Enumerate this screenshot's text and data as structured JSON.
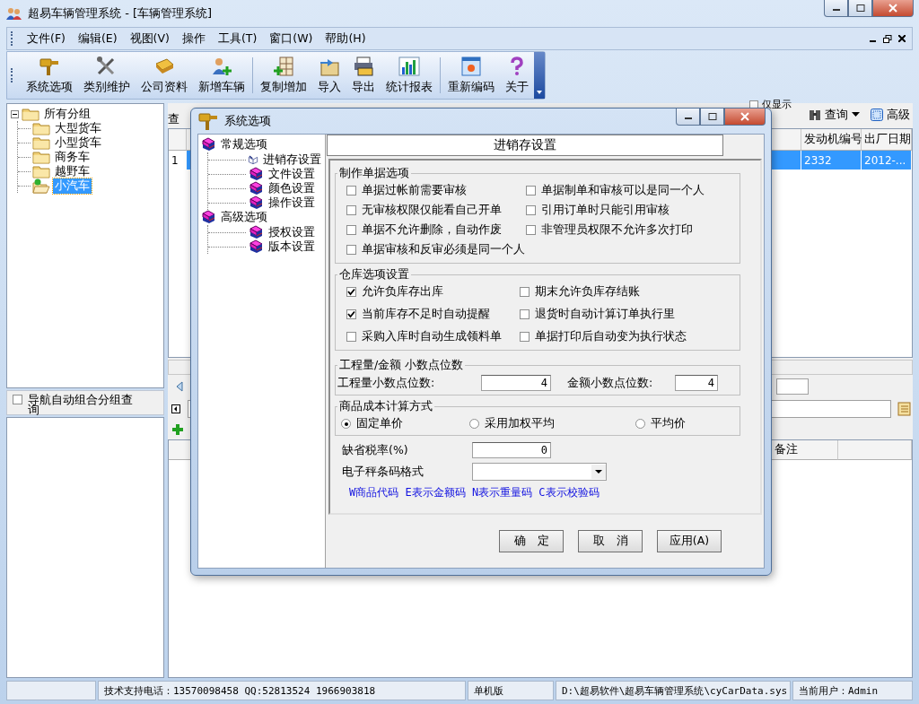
{
  "window": {
    "title": "超易车辆管理系统 - [车辆管理系统]"
  },
  "menu": [
    "文件(F)",
    "编辑(E)",
    "视图(V)",
    "操作",
    "工具(T)",
    "窗口(W)",
    "帮助(H)"
  ],
  "toolbar": [
    {
      "label": "系统选项",
      "separator_before": false
    },
    {
      "label": "类别维护",
      "separator_before": false
    },
    {
      "label": "公司资料",
      "separator_before": false
    },
    {
      "label": "新增车辆",
      "separator_before": false
    },
    {
      "label": "复制增加",
      "separator_before": true
    },
    {
      "label": "导入",
      "separator_before": false
    },
    {
      "label": "导出",
      "separator_before": false
    },
    {
      "label": "统计报表",
      "separator_before": false
    },
    {
      "label": "重新编码",
      "separator_before": true
    },
    {
      "label": "关于",
      "separator_before": false
    }
  ],
  "nav_tree": [
    {
      "label": "所有分组",
      "expanded": true,
      "selected": false,
      "children": [
        {
          "label": "大型货车",
          "selected": false
        },
        {
          "label": "小型货车",
          "selected": false
        },
        {
          "label": "商务车",
          "selected": false
        },
        {
          "label": "越野车",
          "selected": false
        },
        {
          "label": "小汽车",
          "selected": true
        }
      ]
    }
  ],
  "nav_option": {
    "label": "导航自动组合分组查询",
    "checked": false
  },
  "query_bar": {
    "label": "查",
    "only_show": {
      "label": "仅显示",
      "checked": false
    },
    "buttons": [
      "查询",
      "高级"
    ]
  },
  "table": {
    "columns": [
      "发动机编号",
      "出厂日期"
    ],
    "rows": [
      {
        "row_number": "1",
        "cells": [
          "2332",
          "2012-..."
        ],
        "selected": true
      }
    ]
  },
  "detail_grid": {
    "columns": [
      "备注"
    ]
  },
  "status_bar": [
    "技术支持电话：13570098458 QQ:52813524 1966903818",
    "单机版",
    "D:\\超易软件\\超易车辆管理系统\\cyCarData.sys",
    "当前用户：Admin"
  ],
  "dialog": {
    "title": "系统选项",
    "tree": [
      {
        "label": "常规选项",
        "selected": false,
        "children": [
          {
            "label": "进销存设置",
            "selected": true
          },
          {
            "label": "文件设置",
            "selected": false
          },
          {
            "label": "颜色设置",
            "selected": false
          },
          {
            "label": "操作设置",
            "selected": false
          }
        ]
      },
      {
        "label": "高级选项",
        "selected": false,
        "children": [
          {
            "label": "授权设置",
            "selected": false
          },
          {
            "label": "版本设置",
            "selected": false
          }
        ]
      }
    ],
    "heading": "进销存设置",
    "check_groups": [
      {
        "title": "制作单据选项",
        "items": [
          {
            "label": "单据过帐前需要审核",
            "checked": false
          },
          {
            "label": "单据制单和审核可以是同一个人",
            "checked": false
          },
          {
            "label": "无审核权限仅能看自己开单",
            "checked": false
          },
          {
            "label": "引用订单时只能引用审核",
            "checked": false
          },
          {
            "label": "单据不允许删除，自动作废",
            "checked": false
          },
          {
            "label": "非管理员权限不允许多次打印",
            "checked": false
          },
          {
            "label": "单据审核和反审必须是同一个人",
            "checked": false
          }
        ]
      },
      {
        "title": "仓库选项设置",
        "items": [
          {
            "label": "允许负库存出库",
            "checked": true
          },
          {
            "label": "期末允许负库存结账",
            "checked": false
          },
          {
            "label": "当前库存不足时自动提醒",
            "checked": true
          },
          {
            "label": "退货时自动计算订单执行里",
            "checked": false
          },
          {
            "label": "采购入库时自动生成领料单",
            "checked": false
          },
          {
            "label": "单据打印后自动变为执行状态",
            "checked": false
          }
        ]
      }
    ],
    "decimals": {
      "title": "工程量/金额 小数点位数",
      "fields": [
        {
          "label": "工程量小数点位数:",
          "value": "4"
        },
        {
          "label": "金额小数点位数:",
          "value": "4"
        }
      ]
    },
    "cost_method": {
      "title": "商品成本计算方式",
      "options": [
        {
          "label": "固定单价",
          "selected": true
        },
        {
          "label": "采用加权平均",
          "selected": false
        },
        {
          "label": "平均价",
          "selected": false
        }
      ]
    },
    "tax": {
      "label": "缺省税率(%)",
      "value": "0"
    },
    "barcode": {
      "label": "电子秤条码格式"
    },
    "barcode_hint": "W商品代码 E表示金额码 N表示重量码 C表示校验码",
    "buttons": [
      "确　定",
      "取　消",
      "应用(A)"
    ]
  }
}
